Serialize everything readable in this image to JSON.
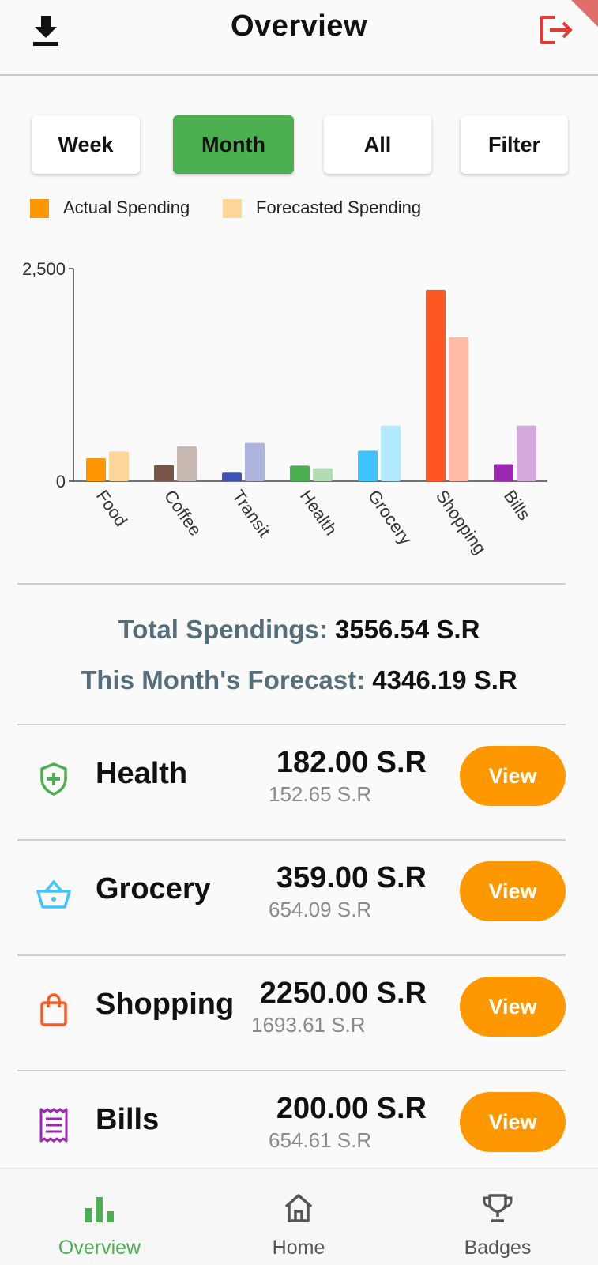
{
  "header": {
    "title": "Overview",
    "download_icon": "download-icon",
    "logout_icon": "logout-icon"
  },
  "periods": {
    "week": "Week",
    "month": "Month",
    "all": "All",
    "filter": "Filter",
    "selected": "Month"
  },
  "legend": {
    "actual": "Actual Spending",
    "forecast": "Forecasted Spending"
  },
  "chart_data": {
    "type": "bar",
    "categories": [
      "Food",
      "Coffee",
      "Transit",
      "Health",
      "Grocery",
      "Shopping",
      "Bills"
    ],
    "series": [
      {
        "name": "Actual Spending",
        "values": [
          270,
          190,
          100,
          182,
          359,
          2250,
          200
        ]
      },
      {
        "name": "Forecasted Spending",
        "values": [
          350,
          410,
          450,
          152.65,
          654.09,
          1693.61,
          654.61
        ]
      }
    ],
    "colors": {
      "actual": [
        "#ff9800",
        "#795548",
        "#3f51b5",
        "#4caf50",
        "#40c4ff",
        "#ff5722",
        "#9c27b0"
      ],
      "forecast": [
        "#ffd699",
        "#c8b8b2",
        "#adb4dd",
        "#b3dbb5",
        "#b3e9ff",
        "#ffbba5",
        "#d6a9de"
      ]
    },
    "yticks": [
      "0",
      "2,500"
    ],
    "ylim": [
      0,
      2500
    ],
    "grid": false
  },
  "summary": {
    "total_label": "Total Spendings:",
    "total_value": "3556.54 S.R",
    "forecast_label": "This Month's Forecast:",
    "forecast_value": "4346.19 S.R"
  },
  "categories": [
    {
      "name": "Health",
      "amount": "182.00 S.R",
      "forecast": "152.65 S.R",
      "icon": "shield-plus-icon",
      "color": "#4caf50",
      "button": "View"
    },
    {
      "name": "Grocery",
      "amount": "359.00 S.R",
      "forecast": "654.09 S.R",
      "icon": "basket-icon",
      "color": "#40c4ff",
      "button": "View"
    },
    {
      "name": "Shopping",
      "amount": "2250.00 S.R",
      "forecast": "1693.61 S.R",
      "icon": "shopping-bag-icon",
      "color": "#ff5722",
      "button": "View"
    },
    {
      "name": "Bills",
      "amount": "200.00 S.R",
      "forecast": "654.61 S.R",
      "icon": "receipt-icon",
      "color": "#9c27b0",
      "button": "View"
    }
  ],
  "nav": {
    "overview": "Overview",
    "home": "Home",
    "badges": "Badges",
    "active": "Overview",
    "active_color": "#4caf50"
  }
}
